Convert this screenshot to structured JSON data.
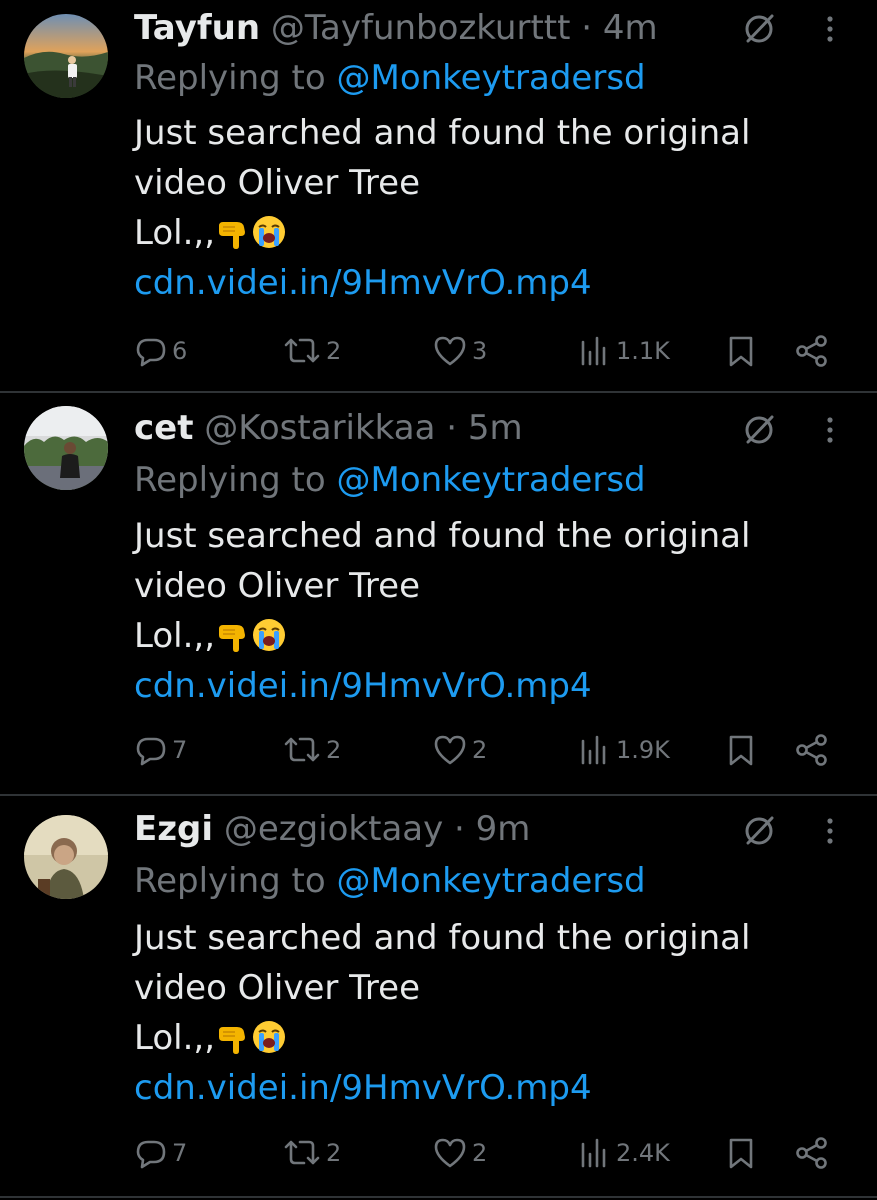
{
  "colors": {
    "background": "#000000",
    "text": "#e7e9ea",
    "muted": "#71767b",
    "link": "#1d9bf0",
    "divider": "#2f3336"
  },
  "tweets": [
    {
      "name": "Tayfun",
      "handle": "@Tayfunbozkurttt",
      "separator": "·",
      "time": "4m",
      "replying_prefix": "Replying to ",
      "replying_to": "@Monkeytradersd",
      "line1": "Just searched and found the original",
      "line2": "video Oliver Tree",
      "line3": "Lol.,,",
      "emojis": [
        "backhand-index-pointing-down",
        "loudly-crying-face"
      ],
      "link": "cdn.videi.in/9HmvVrO.mp4",
      "replies": "6",
      "reposts": "2",
      "likes": "3",
      "views": "1.1K"
    },
    {
      "name": "cet",
      "handle": "@Kostarikkaa",
      "separator": "·",
      "time": "5m",
      "replying_prefix": "Replying to ",
      "replying_to": "@Monkeytradersd",
      "line1": "Just searched and found the original",
      "line2": "video Oliver Tree",
      "line3": "Lol.,,",
      "emojis": [
        "backhand-index-pointing-down",
        "loudly-crying-face"
      ],
      "link": "cdn.videi.in/9HmvVrO.mp4",
      "replies": "7",
      "reposts": "2",
      "likes": "2",
      "views": "1.9K"
    },
    {
      "name": "Ezgi",
      "handle": "@ezgioktaay",
      "separator": "·",
      "time": "9m",
      "replying_prefix": "Replying to ",
      "replying_to": "@Monkeytradersd",
      "line1": "Just searched and found the original",
      "line2": "video Oliver Tree",
      "line3": "Lol.,,",
      "emojis": [
        "backhand-index-pointing-down",
        "loudly-crying-face"
      ],
      "link": "cdn.videi.in/9HmvVrO.mp4",
      "replies": "7",
      "reposts": "2",
      "likes": "2",
      "views": "2.4K"
    }
  ],
  "icons": {
    "reply": "reply-icon",
    "repost": "repost-icon",
    "like": "like-icon",
    "views": "views-icon",
    "bookmark": "bookmark-icon",
    "share": "share-icon",
    "grok": "grok-icon",
    "more": "more-icon"
  }
}
